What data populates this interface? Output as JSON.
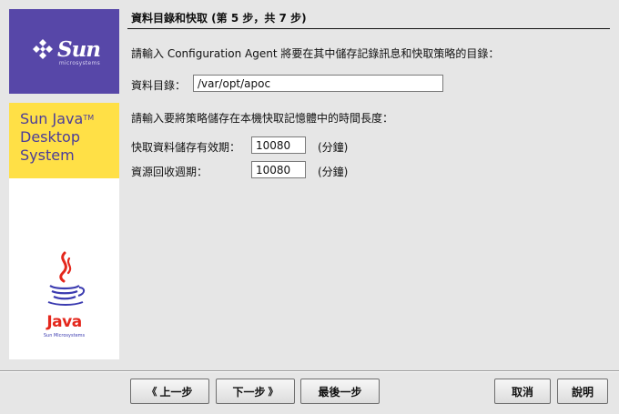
{
  "brand": {
    "sun_word": "Sun",
    "sun_subtitle": "microsystems",
    "product_line1": "Sun Java",
    "product_tm": "TM",
    "product_line2": "Desktop",
    "product_line3": "System",
    "java_word": "Java",
    "java_subtitle": "Sun Microsystems"
  },
  "header": {
    "title": "資料目錄和快取 (第 5 步，共 7 步)"
  },
  "form": {
    "dir_prompt": "請輸入 Configuration Agent 將要在其中儲存記錄訊息和快取策略的目錄：",
    "dir_label": "資料目錄：",
    "dir_value": "/var/opt/apoc",
    "cache_prompt": "請輸入要將策略儲存在本機快取記憶體中的時間長度：",
    "ttl_label": "快取資料儲存有效期：",
    "ttl_value": "10080",
    "ttl_unit": "(分鐘)",
    "gc_label": "資源回收週期：",
    "gc_value": "10080",
    "gc_unit": "(分鐘)"
  },
  "buttons": {
    "back": "上一步",
    "next": "下一步",
    "last": "最後一步",
    "cancel": "取消",
    "help": "說明"
  },
  "colors": {
    "sun_purple": "#5747a8",
    "jds_yellow": "#ffe046",
    "java_red": "#e4271c",
    "java_blue": "#3b3bb0"
  },
  "icons": {
    "back": "double-chevron-left-icon",
    "next": "double-chevron-right-icon"
  }
}
